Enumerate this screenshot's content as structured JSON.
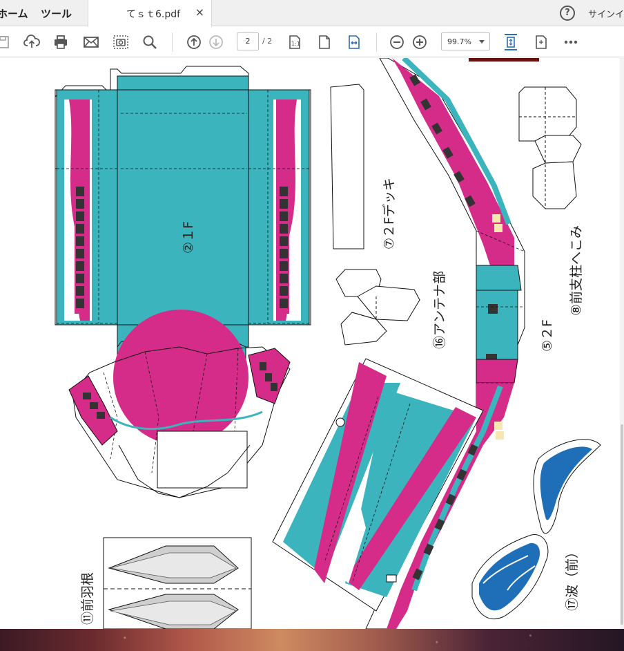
{
  "menubar": {
    "home_label": "ホーム",
    "tools_label": "ツール",
    "tab_title": "てｓｔ6.pdf",
    "close_glyph": "×",
    "help_glyph": "?",
    "signin_label": "サインイ"
  },
  "toolbar": {
    "icons": [
      "save-icon",
      "upload-icon",
      "print-icon",
      "mail-icon",
      "snapshot-icon",
      "search-icon",
      "page-up-icon",
      "page-down-icon",
      "page-display-icon",
      "single-page-icon",
      "fit-width-icon",
      "zoom-out-icon",
      "zoom-in-icon",
      "fit-page-icon",
      "rotate-icon",
      "more-icon"
    ],
    "current_page": "2",
    "total_pages": "/ 2",
    "zoom": "99.7%"
  },
  "document": {
    "labels": {
      "first_floor": "②１F",
      "second_deck": "⑦２Fデッキ",
      "antenna": "⑯アンテナ部",
      "second_floor": "⑤２F",
      "front_pillar": "⑧前支柱へこみ",
      "front_wing": "⑪前羽根",
      "wave_front": "⑰波（前）"
    },
    "colors": {
      "teal": "#3bb4bd",
      "magenta": "#d42c88",
      "wave_blue": "#1e6fb8",
      "dark_red_bar": "#6a1010"
    }
  }
}
